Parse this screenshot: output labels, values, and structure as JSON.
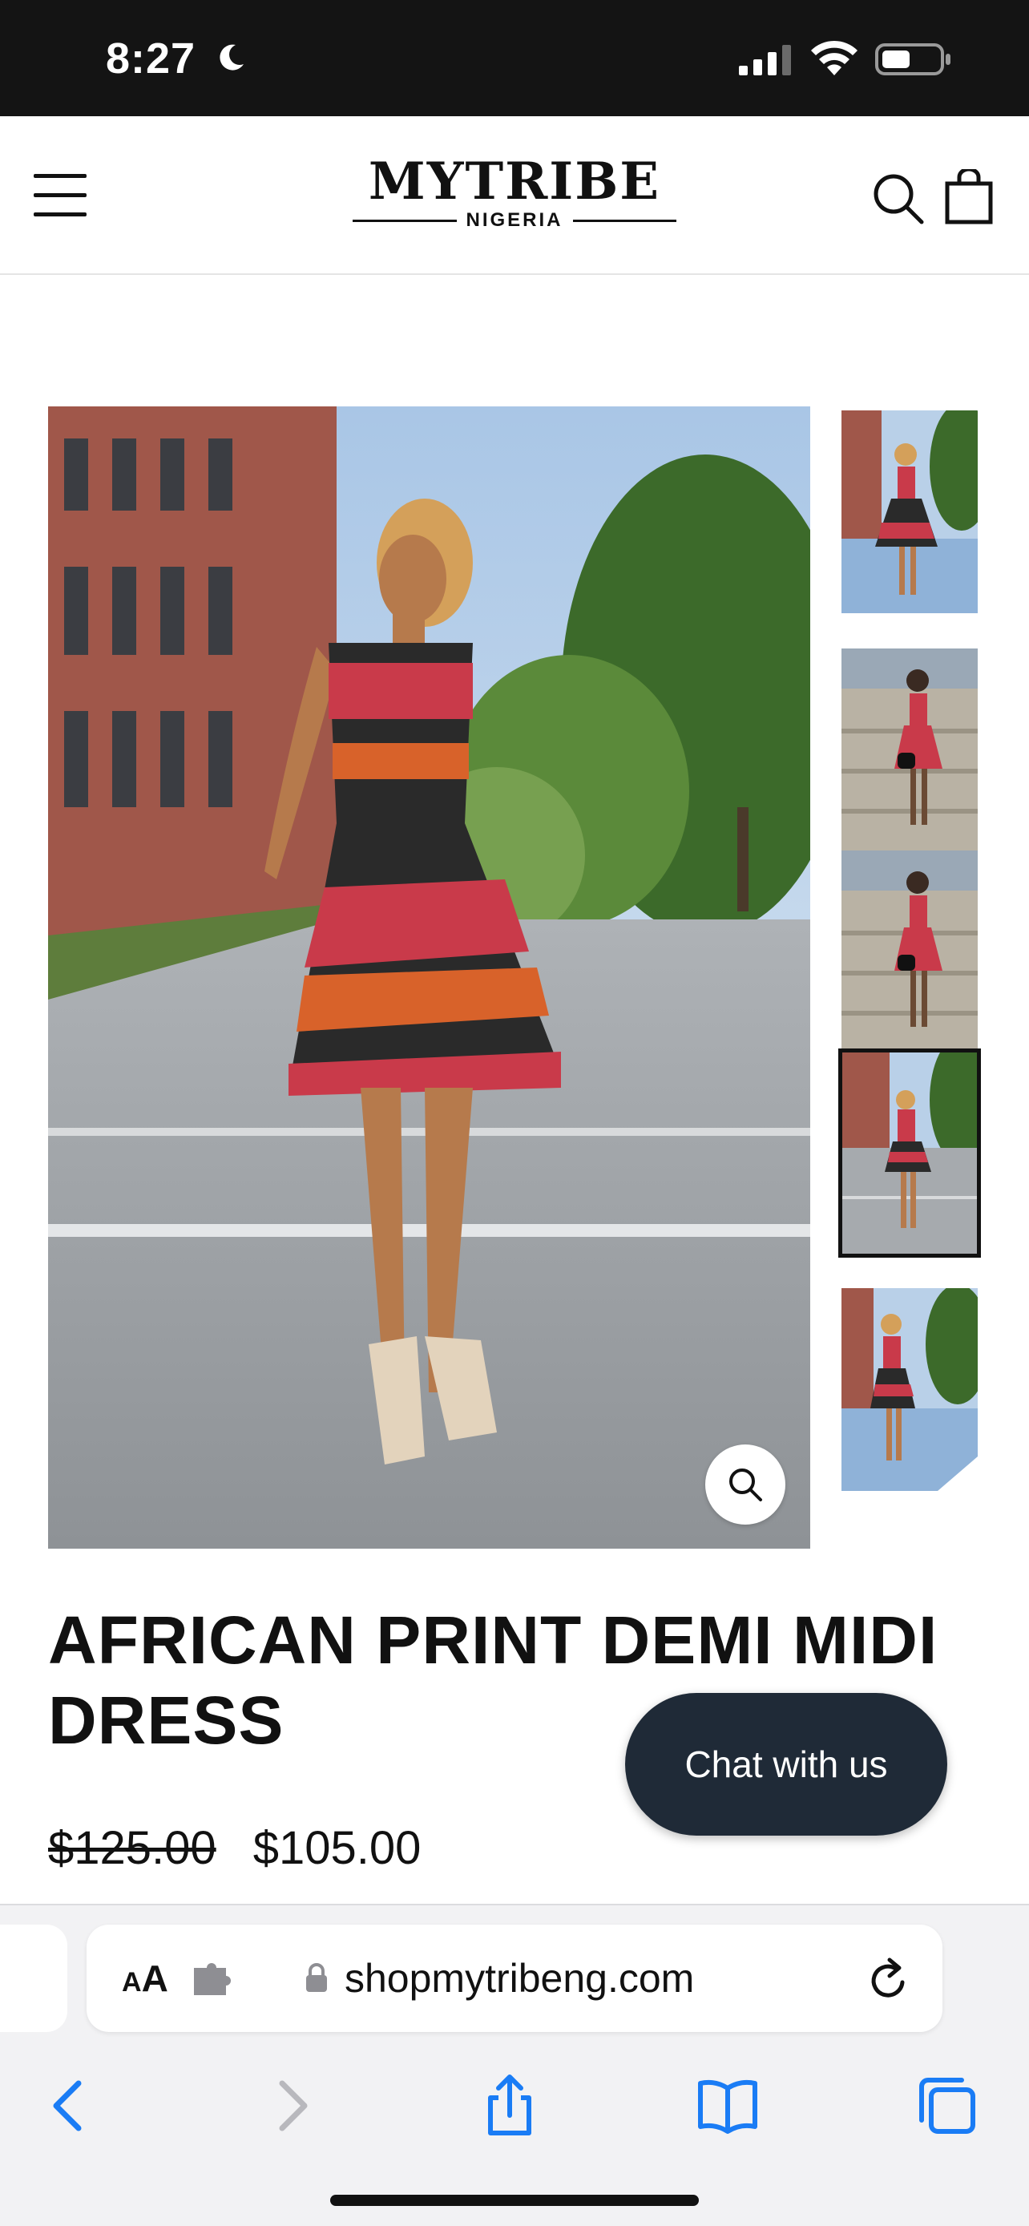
{
  "status_bar": {
    "time": "8:27",
    "focus_icon": "moon-icon",
    "signal_icon": "cellular-signal-icon",
    "wifi_icon": "wifi-icon",
    "battery_icon": "battery-icon"
  },
  "header": {
    "menu_icon": "hamburger-menu-icon",
    "logo_main": "MYTRIBE",
    "logo_sub": "NIGERIA",
    "search_icon": "search-icon",
    "cart_icon": "shopping-bag-icon"
  },
  "product": {
    "title": "AFRICAN PRINT DEMI MIDI DRESS",
    "price_original": "$125.00",
    "price_sale": "$105.00",
    "zoom_icon": "magnify-icon",
    "thumbnails": [
      {
        "label": "full-length-front-view"
      },
      {
        "label": "front-view-on-steps"
      },
      {
        "label": "front-view-on-steps-2"
      },
      {
        "label": "back-view-walking"
      },
      {
        "label": "full-length-front-view-2"
      }
    ],
    "active_thumbnail_index": 3
  },
  "chat": {
    "label": "Chat with us"
  },
  "browser": {
    "text_size_label": "AA",
    "extensions_icon": "puzzle-icon",
    "lock_icon": "lock-icon",
    "url": "shopmytribeng.com",
    "reload_icon": "reload-icon",
    "toolbar": [
      "back-icon",
      "forward-icon",
      "share-icon",
      "bookmarks-icon",
      "tabs-icon"
    ]
  },
  "colors": {
    "status_bar_bg": "#141414",
    "chat_bg": "#1f2a37",
    "safari_blue": "#1a7cf5",
    "toolbar_disabled": "#b8b8bd"
  }
}
